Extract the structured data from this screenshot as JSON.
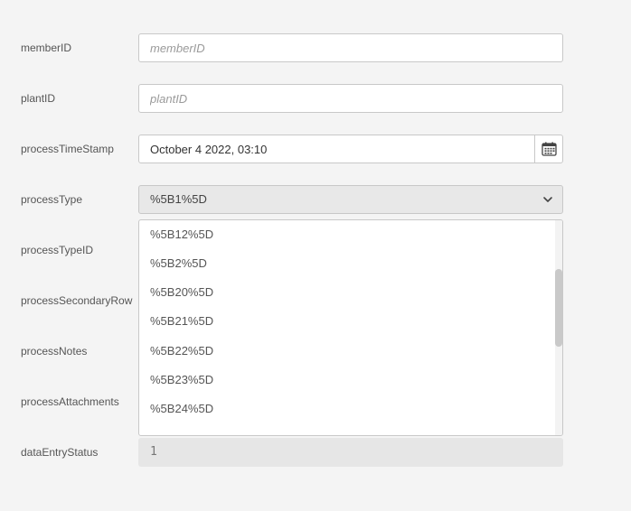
{
  "form": {
    "fields": [
      {
        "label": "memberID",
        "placeholder": "memberID",
        "value": ""
      },
      {
        "label": "plantID",
        "placeholder": "plantID",
        "value": ""
      },
      {
        "label": "processTimeStamp",
        "value": "October 4 2022, 03:10"
      },
      {
        "label": "processType",
        "selected": "%5B1%5D"
      },
      {
        "label": "processTypeID"
      },
      {
        "label": "processSecondaryRow"
      },
      {
        "label": "processNotes"
      },
      {
        "label": "processAttachments"
      },
      {
        "label": "dataEntryStatus",
        "value": "1"
      }
    ]
  },
  "dropdown": {
    "options": [
      "%5B12%5D",
      "%5B2%5D",
      "%5B20%5D",
      "%5B21%5D",
      "%5B22%5D",
      "%5B23%5D",
      "%5B24%5D"
    ],
    "scroll_position": 0.25
  },
  "icons": {
    "calendar": "calendar-icon",
    "chevron": "chevron-down-icon"
  },
  "colors": {
    "background": "#f4f4f4",
    "border": "#c8c8c8",
    "select_bg": "#e8e8e8",
    "readonly_bg": "#e6e6e6"
  }
}
